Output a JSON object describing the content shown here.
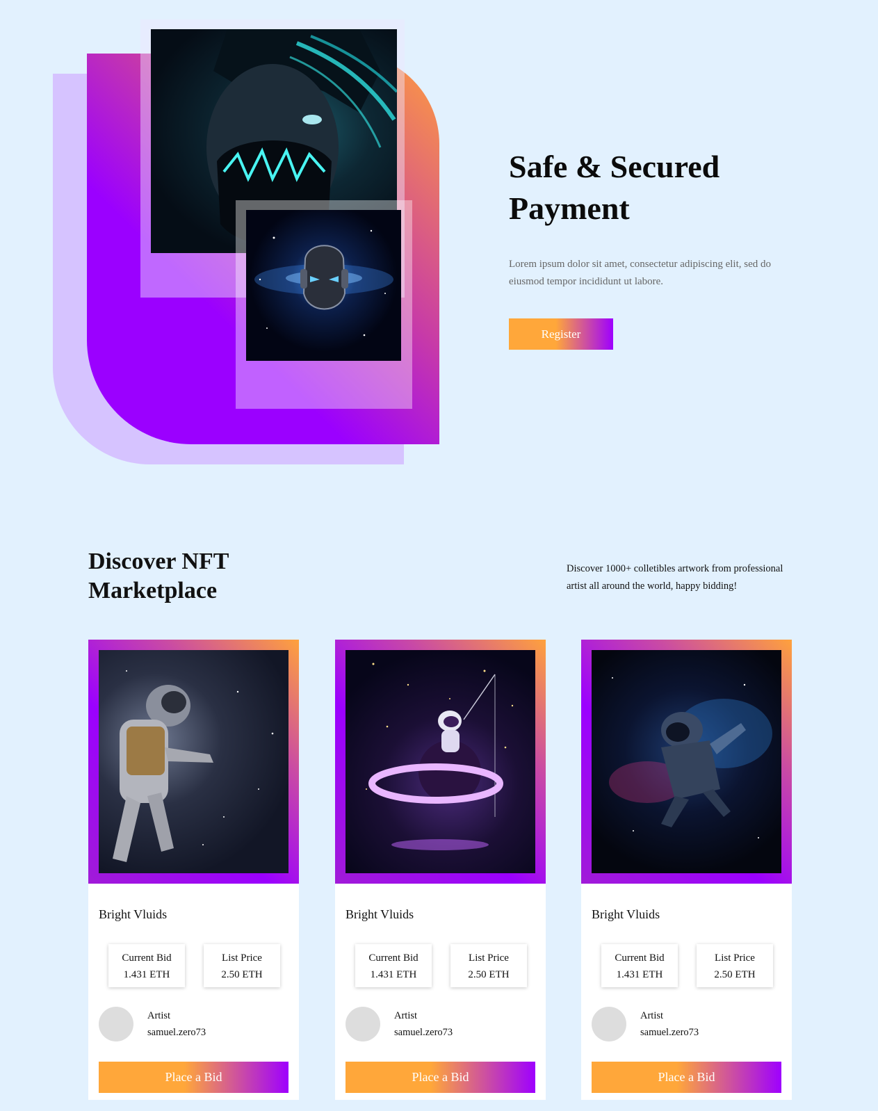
{
  "hero": {
    "title": "Safe & Secured Payment",
    "description": "Lorem ipsum dolor sit amet, consectetur adipiscing elit, sed do eiusmod tempor incididunt ut labore.",
    "register_label": "Register"
  },
  "market": {
    "title": "Discover NFT Marketplace",
    "description": "Discover 1000+ colletibles artwork from professional artist all around the world, happy bidding!",
    "cards": [
      {
        "name": "Bright Vluids",
        "current_bid_label": "Current Bid",
        "current_bid_value": "1.431 ETH",
        "list_price_label": "List Price",
        "list_price_value": "2.50 ETH",
        "artist_label": "Artist",
        "artist_name": "samuel.zero73",
        "bid_label": "Place a Bid"
      },
      {
        "name": "Bright Vluids",
        "current_bid_label": "Current Bid",
        "current_bid_value": "1.431 ETH",
        "list_price_label": "List Price",
        "list_price_value": "2.50 ETH",
        "artist_label": "Artist",
        "artist_name": "samuel.zero73",
        "bid_label": "Place a Bid"
      },
      {
        "name": "Bright Vluids",
        "current_bid_label": "Current Bid",
        "current_bid_value": "1.431 ETH",
        "list_price_label": "List Price",
        "list_price_value": "2.50 ETH",
        "artist_label": "Artist",
        "artist_name": "samuel.zero73",
        "bid_label": "Place a Bid"
      }
    ]
  },
  "colors": {
    "background": "#e2f1fe",
    "accent_purple": "#9b00ff",
    "accent_orange": "#ffa73a"
  }
}
